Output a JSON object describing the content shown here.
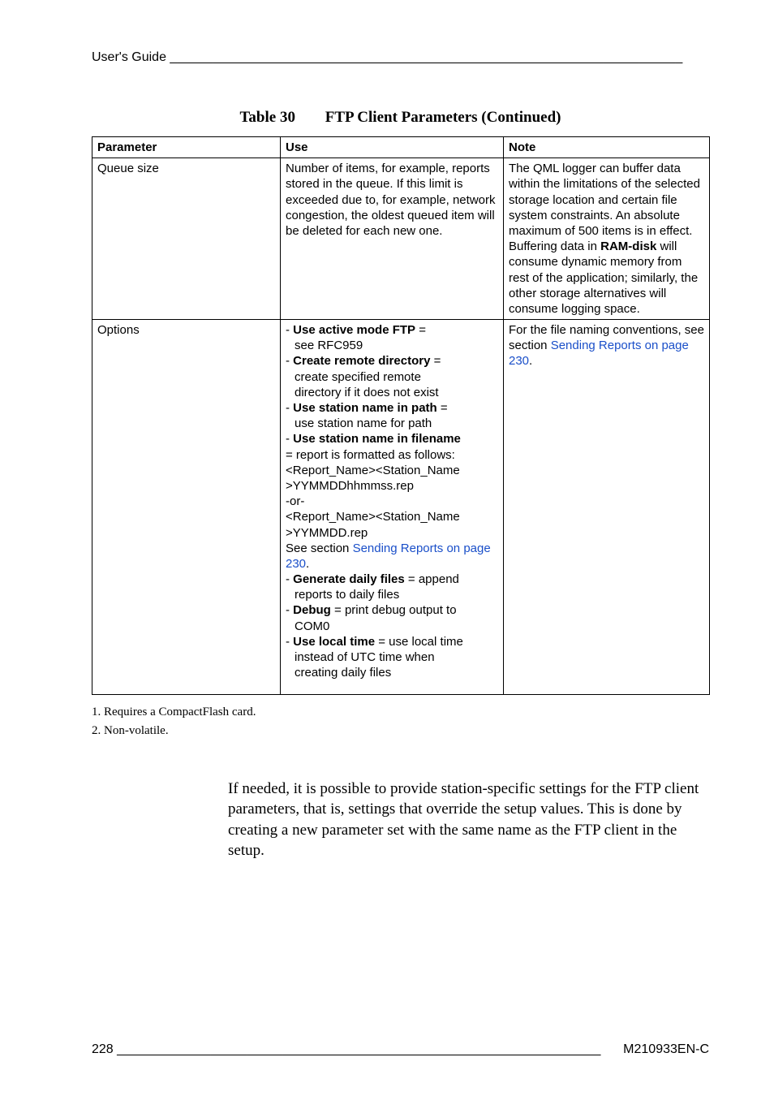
{
  "header": {
    "text": "User's Guide _______________________________________________________________________"
  },
  "caption": {
    "label": "Table 30",
    "title": "FTP Client Parameters (Continued)"
  },
  "table": {
    "headers": [
      "Parameter",
      "Use",
      "Note"
    ],
    "rows": [
      {
        "param": "Queue size",
        "use_plain": "Number of items, for example, reports stored in the queue. If this limit is exceeded due to, for example, network congestion, the oldest queued item will be deleted for each new one.",
        "note_parts": {
          "p1": "The QML logger can buffer data within the limitations of the selected storage location and certain file system constraints. An absolute maximum of 500 items is in effect. Buffering data in ",
          "ram": "RAM-disk",
          "p2": " will consume dynamic memory from rest of the application; similarly, the other storage alternatives will consume logging space."
        }
      },
      {
        "param": "Options",
        "opts": {
          "l1a": "- ",
          "l1b": "Use active mode FTP",
          "l1c": " =",
          "l2": "see RFC959",
          "l3a": "- ",
          "l3b": "Create remote directory",
          "l3c": " =",
          "l4": "create specified remote",
          "l5": "directory if it does not exist",
          "l6a": "- ",
          "l6b": "Use station name in path",
          "l6c": " =",
          "l7": "use station name for path",
          "l8a": "- ",
          "l8b": "Use station name in filename",
          "l9": "= report is formatted as follows:",
          "l10": "<Report_Name><Station_Name",
          "l11": ">YYMMDDhhmmss.rep",
          "l12": "-or-",
          "l13": "<Report_Name><Station_Name",
          "l14": ">YYMMDD.rep",
          "l15a": "See section ",
          "l15link": "Sending Reports on page 230",
          "l15b": ".",
          "l16a": "- ",
          "l16b": "Generate daily files",
          "l16c": " = append",
          "l17": "reports to daily files",
          "l18a": "- ",
          "l18b": "Debug",
          "l18c": " = print debug output to",
          "l19": "COM0",
          "l20a": "- ",
          "l20b": "Use local time",
          "l20c": " = use local time",
          "l21": "instead of UTC time when",
          "l22": "creating daily files"
        },
        "note_parts": {
          "p1": "For the file naming conventions, see section ",
          "link": "Sending Reports on page 230",
          "p2": "."
        }
      }
    ]
  },
  "footnotes": {
    "f1": "1.  Requires a CompactFlash card.",
    "f2": "2.  Non-volatile."
  },
  "body": {
    "para": "If needed, it is possible to provide station-specific settings for the FTP client parameters, that is, settings that override the setup values. This is done by creating a new parameter set with the same name as the FTP client in the setup."
  },
  "footer": {
    "page": "228",
    "fill": " ___________________________________________________________________ ",
    "docid": "M210933EN-C"
  }
}
